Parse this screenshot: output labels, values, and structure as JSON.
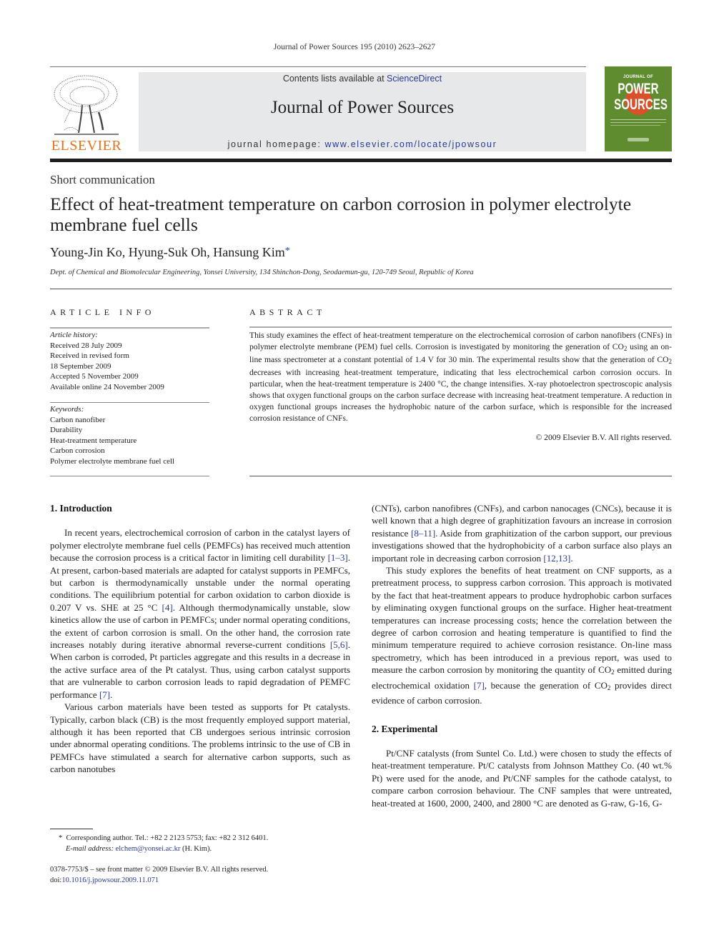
{
  "running_head": "Journal of Power Sources 195 (2010) 2623–2627",
  "masthead": {
    "publisher_name": "ELSEVIER",
    "contents_prefix": "Contents lists available at ",
    "contents_link": "ScienceDirect",
    "journal_title": "Journal of Power Sources",
    "homepage_prefix": "journal homepage: ",
    "homepage_link": "www.elsevier.com/locate/jpowsour",
    "cover": {
      "line1": "JOURNAL OF",
      "line2": "POWER",
      "line3": "SOURCES",
      "background_color": "#5e8c2f",
      "accent_color": "#d9512a"
    },
    "publisher_color": "#e9711c",
    "link_color": "#2a3a8f"
  },
  "article": {
    "type": "Short communication",
    "title": "Effect of heat-treatment temperature on carbon corrosion in polymer electrolyte membrane fuel cells",
    "authors": "Young-Jin Ko, Hyung-Suk Oh, Hansung Kim",
    "author_marker": "*",
    "affiliation": "Dept. of Chemical and Biomolecular Engineering, Yonsei University, 134 Shinchon-Dong, Seodaemun-gu, 120-749 Seoul, Republic of Korea"
  },
  "article_info": {
    "heading": "ARTICLE INFO",
    "history_label": "Article history:",
    "history": [
      "Received 28 July 2009",
      "Received in revised form",
      "18 September 2009",
      "Accepted 5 November 2009",
      "Available online 24 November 2009"
    ],
    "keywords_label": "Keywords:",
    "keywords": [
      "Carbon nanofiber",
      "Durability",
      "Heat-treatment temperature",
      "Carbon corrosion",
      "Polymer electrolyte membrane fuel cell"
    ]
  },
  "abstract": {
    "heading": "ABSTRACT",
    "parts": [
      "This study examines the effect of heat-treatment temperature on the electrochemical corrosion of carbon nanofibers (CNFs) in polymer electrolyte membrane (PEM) fuel cells. Corrosion is investigated by monitoring the generation of CO",
      " using an on-line mass spectrometer at a constant potential of 1.4 V for 30 min. The experimental results show that the generation of CO",
      " decreases with increasing heat-treatment temperature, indicating that less electrochemical carbon corrosion occurs. In particular, when the heat-treatment temperature is 2400 °C, the change intensifies. X-ray photoelectron spectroscopic analysis shows that oxygen functional groups on the carbon surface decrease with increasing heat-treatment temperature. A reduction in oxygen functional groups increases the hydrophobic nature of the carbon surface, which is responsible for the increased corrosion resistance of CNFs."
    ],
    "subscript": "2",
    "copyright": "© 2009 Elsevier B.V. All rights reserved."
  },
  "sections": {
    "intro_heading": "1.  Introduction",
    "intro_p1": [
      "In recent years, electrochemical corrosion of carbon in the catalyst layers of polymer electrolyte membrane fuel cells (PEMFCs) has received much attention because the corrosion process is a critical factor in limiting cell durability ",
      "[1–3]",
      ". At present, carbon-based materials are adapted for catalyst supports in PEMFCs, but carbon is thermodynamically unstable under the normal operating conditions. The equilibrium potential for carbon oxidation to carbon dioxide is 0.207 V vs. SHE at 25 °C ",
      "[4]",
      ". Although thermodynamically unstable, slow kinetics allow the use of carbon in PEMFCs; under normal operating conditions, the extent of carbon corrosion is small. On the other hand, the corrosion rate increases notably during iterative abnormal reverse-current conditions ",
      "[5,6]",
      ". When carbon is corroded, Pt particles aggregate and this results in a decrease in the active surface area of the Pt catalyst. Thus, using carbon catalyst supports that are vulnerable to carbon corrosion leads to rapid degradation of PEMFC performance ",
      "[7]",
      "."
    ],
    "intro_p2": "Various carbon materials have been tested as supports for Pt catalysts. Typically, carbon black (CB) is the most frequently employed support material, although it has been reported that CB undergoes serious intrinsic corrosion under abnormal operating conditions. The problems intrinsic to the use of CB in PEMFCs have stimulated a search for alternative carbon supports, such as carbon nanotubes",
    "right_p1": [
      "(CNTs), carbon nanofibres (CNFs), and carbon nanocages (CNCs), because it is well known that a high degree of graphitization favours an increase in corrosion resistance ",
      "[8–11]",
      ". Aside from graphitization of the carbon support, our previous investigations showed that the hydrophobicity of a carbon surface also plays an important role in decreasing carbon corrosion ",
      "[12,13]",
      "."
    ],
    "right_p2": [
      "This study explores the benefits of heat treatment on CNF supports, as a pretreatment process, to suppress carbon corrosion. This approach is motivated by the fact that heat-treatment appears to produce hydrophobic carbon surfaces by eliminating oxygen functional groups on the surface. Higher heat-treatment temperatures can increase processing costs; hence the correlation between the degree of carbon corrosion and heating temperature is quantified to find the minimum temperature required to achieve corrosion resistance. On-line mass spectrometry, which has been introduced in a previous report, was used to measure the carbon corrosion by monitoring the quantity of CO",
      "2",
      " emitted during electrochemical oxidation ",
      "[7]",
      ", because the generation of CO",
      "2",
      " provides direct evidence of carbon corrosion."
    ],
    "exp_heading": "2.  Experimental",
    "exp_p1": "Pt/CNF catalysts (from Suntel Co. Ltd.) were chosen to study the effects of heat-treatment temperature. Pt/C catalysts from Johnson Matthey Co. (40 wt.% Pt) were used for the anode, and Pt/CNF samples for the cathode catalyst, to compare carbon corrosion behaviour. The CNF samples that were untreated, heat-treated at 1600, 2000, 2400, and 2800 °C are denoted as G-raw, G-16, G-"
  },
  "footnotes": {
    "marker": "*",
    "corresponding": "Corresponding author. Tel.: +82 2 2123 5753; fax: +82 2 312 6401.",
    "email_label": "E-mail address:",
    "email": "elchem@yonsei.ac.kr",
    "email_suffix": " (H. Kim).",
    "issn_line": "0378-7753/$ – see front matter © 2009 Elsevier B.V. All rights reserved.",
    "doi_prefix": "doi:",
    "doi": "10.1016/j.jpowsour.2009.11.071"
  }
}
